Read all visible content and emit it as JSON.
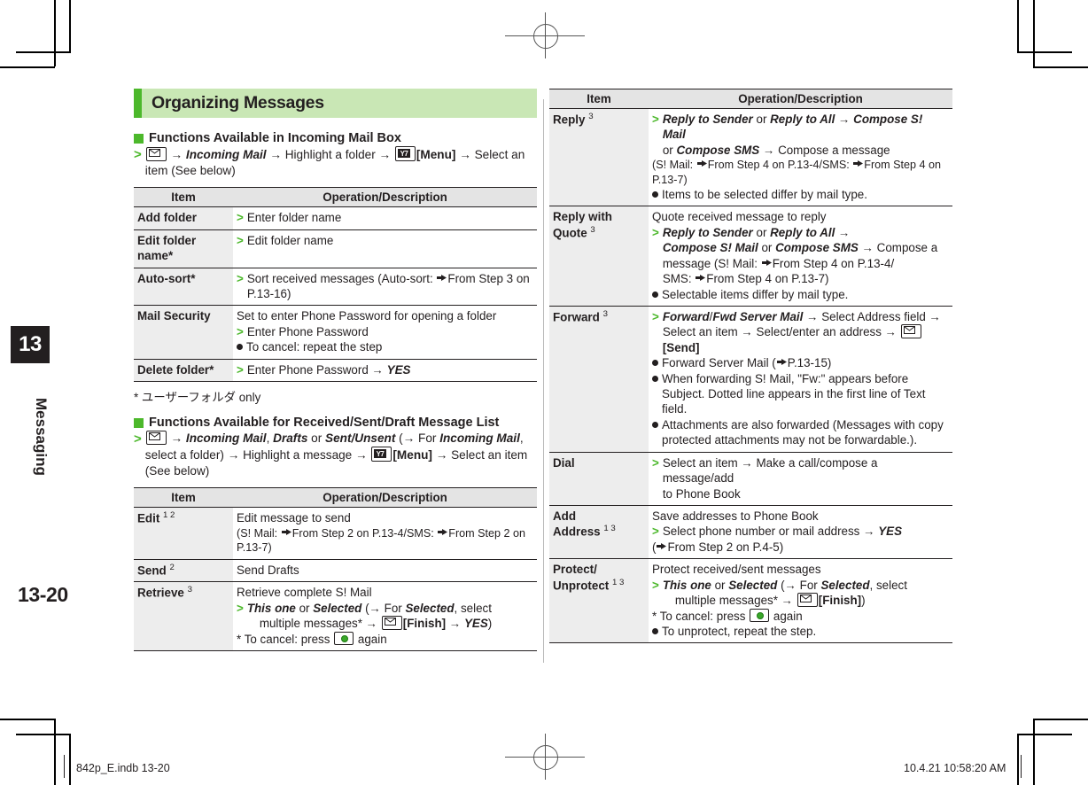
{
  "page": {
    "number": "13-20",
    "chapter_number": "13",
    "chapter_name": "Messaging",
    "footer_left": "842p_E.indb   13-20",
    "footer_right": "10.4.21   10:58:20 AM",
    "accent_green": "#4cb82b",
    "band_green": "#c9e7b5",
    "table_header_gray": "#e4e4e4",
    "item_col_gray": "#ededed"
  },
  "section": {
    "title": "Organizing Messages"
  },
  "block1": {
    "heading": "Functions Available in Incoming Mail Box",
    "step_pre": " ",
    "step": {
      "a": "Incoming Mail",
      "b": "Highlight a folder",
      "c": "[Menu]",
      "d": "Select an item (See below)"
    },
    "table": {
      "headers": [
        "Item",
        "Operation/Description"
      ],
      "rows": [
        {
          "item": "Add folder",
          "lines": [
            {
              "type": "step",
              "text": "Enter folder name"
            }
          ]
        },
        {
          "item": "Edit folder name*",
          "lines": [
            {
              "type": "step",
              "text": "Edit folder name"
            }
          ]
        },
        {
          "item": "Auto-sort*",
          "lines": [
            {
              "type": "step",
              "text": "Sort received messages (Auto-sort: From Step 3 on P.13-16)"
            }
          ]
        },
        {
          "item": "Mail Security",
          "lines": [
            {
              "type": "plain",
              "text": "Set to enter Phone Password for opening a folder"
            },
            {
              "type": "step",
              "text": "Enter Phone Password"
            },
            {
              "type": "bullet",
              "text": "To cancel: repeat the step"
            }
          ]
        },
        {
          "item": "Delete folder*",
          "lines": [
            {
              "type": "step",
              "text": "Enter Phone Password  YES"
            }
          ]
        }
      ]
    },
    "footnote": "* ユーザーフォルダ only"
  },
  "block2": {
    "heading": "Functions Available for Received/Sent/Draft Message List",
    "step": {
      "a": "Incoming Mail",
      "b": "Drafts",
      "c": "Sent/Unsent",
      "d": "For Incoming Mail, select a folder)",
      "e": "Highlight a message",
      "f": "[Menu]",
      "g": "Select an item (See below)"
    },
    "table": {
      "headers": [
        "Item",
        "Operation/Description"
      ],
      "rows": [
        {
          "item": "Edit",
          "sup": "1 2",
          "lines": [
            {
              "type": "plain",
              "text": "Edit message to send"
            },
            {
              "type": "ref",
              "text": "(S! Mail: From Step 2 on P.13-4/SMS: From Step 2 on P.13-7)"
            }
          ]
        },
        {
          "item": "Send",
          "sup": "2",
          "lines": [
            {
              "type": "plain",
              "text": "Send Drafts"
            }
          ]
        },
        {
          "item": "Retrieve",
          "sup": "3",
          "lines": [
            {
              "type": "plain",
              "text": "Retrieve complete S! Mail"
            },
            {
              "type": "step",
              "text": "This one or Selected ( For Selected, select multiple messages*  [Finish]  YES)"
            },
            {
              "type": "plain",
              "text": "* To cancel: press  again"
            }
          ]
        }
      ]
    }
  },
  "right_table": {
    "headers": [
      "Item",
      "Operation/Description"
    ],
    "rows": [
      {
        "item": "Reply",
        "sup": "3",
        "lines": [
          {
            "type": "step",
            "text": "Reply to Sender or Reply to All  Compose S! Mail or Compose SMS  Compose a message"
          },
          {
            "type": "ref",
            "text": "(S! Mail: From Step 4 on P.13-4/SMS: From Step 4 on P.13-7)"
          },
          {
            "type": "bullet",
            "text": "Items to be selected differ by mail type."
          }
        ]
      },
      {
        "item": "Reply with Quote",
        "sup": "3",
        "lines": [
          {
            "type": "plain",
            "text": "Quote received message to reply"
          },
          {
            "type": "step",
            "text": "Reply to Sender or Reply to All  Compose S! Mail or Compose SMS  Compose a message (S! Mail: From Step 4 on P.13-4/ SMS: From Step 4 on P.13-7)"
          },
          {
            "type": "bullet",
            "text": "Selectable items differ by mail type."
          }
        ]
      },
      {
        "item": "Forward",
        "sup": "3",
        "lines": [
          {
            "type": "step",
            "text": "Forward/Fwd Server Mail  Select Address field  Select an item  Select/enter an address  [Send]"
          },
          {
            "type": "bullet",
            "text": "Forward Server Mail ( P.13-15)"
          },
          {
            "type": "bullet",
            "text": "When forwarding S! Mail, \"Fw:\" appears before Subject. Dotted line appears in the first line of Text field."
          },
          {
            "type": "bullet",
            "text": "Attachments are also forwarded (Messages with copy protected attachments may not be forwardable.)."
          }
        ]
      },
      {
        "item": "Dial",
        "lines": [
          {
            "type": "step",
            "text": "Select an item  Make a call/compose a message/add to Phone Book"
          }
        ]
      },
      {
        "item": "Add Address",
        "sup": "1 3",
        "lines": [
          {
            "type": "plain",
            "text": "Save addresses to Phone Book"
          },
          {
            "type": "step",
            "text": "Select phone number or mail address  YES"
          },
          {
            "type": "ref",
            "text": "( From Step 2 on P.4-5)"
          }
        ]
      },
      {
        "item": "Protect/ Unprotect",
        "sup": "1 3",
        "lines": [
          {
            "type": "plain",
            "text": "Protect received/sent messages"
          },
          {
            "type": "step",
            "text": "This one or Selected ( For Selected, select multiple messages*  [Finish])"
          },
          {
            "type": "plain",
            "text": "* To cancel: press  again"
          },
          {
            "type": "bullet",
            "text": "To unprotect, repeat the step."
          }
        ]
      }
    ]
  },
  "icons": {
    "mail_key": "envelope-key-icon",
    "menu_key": "yahoo-menu-key-icon",
    "center_key": "center-select-key-icon",
    "reference": "reference-pointer-icon",
    "arrow": "→"
  }
}
